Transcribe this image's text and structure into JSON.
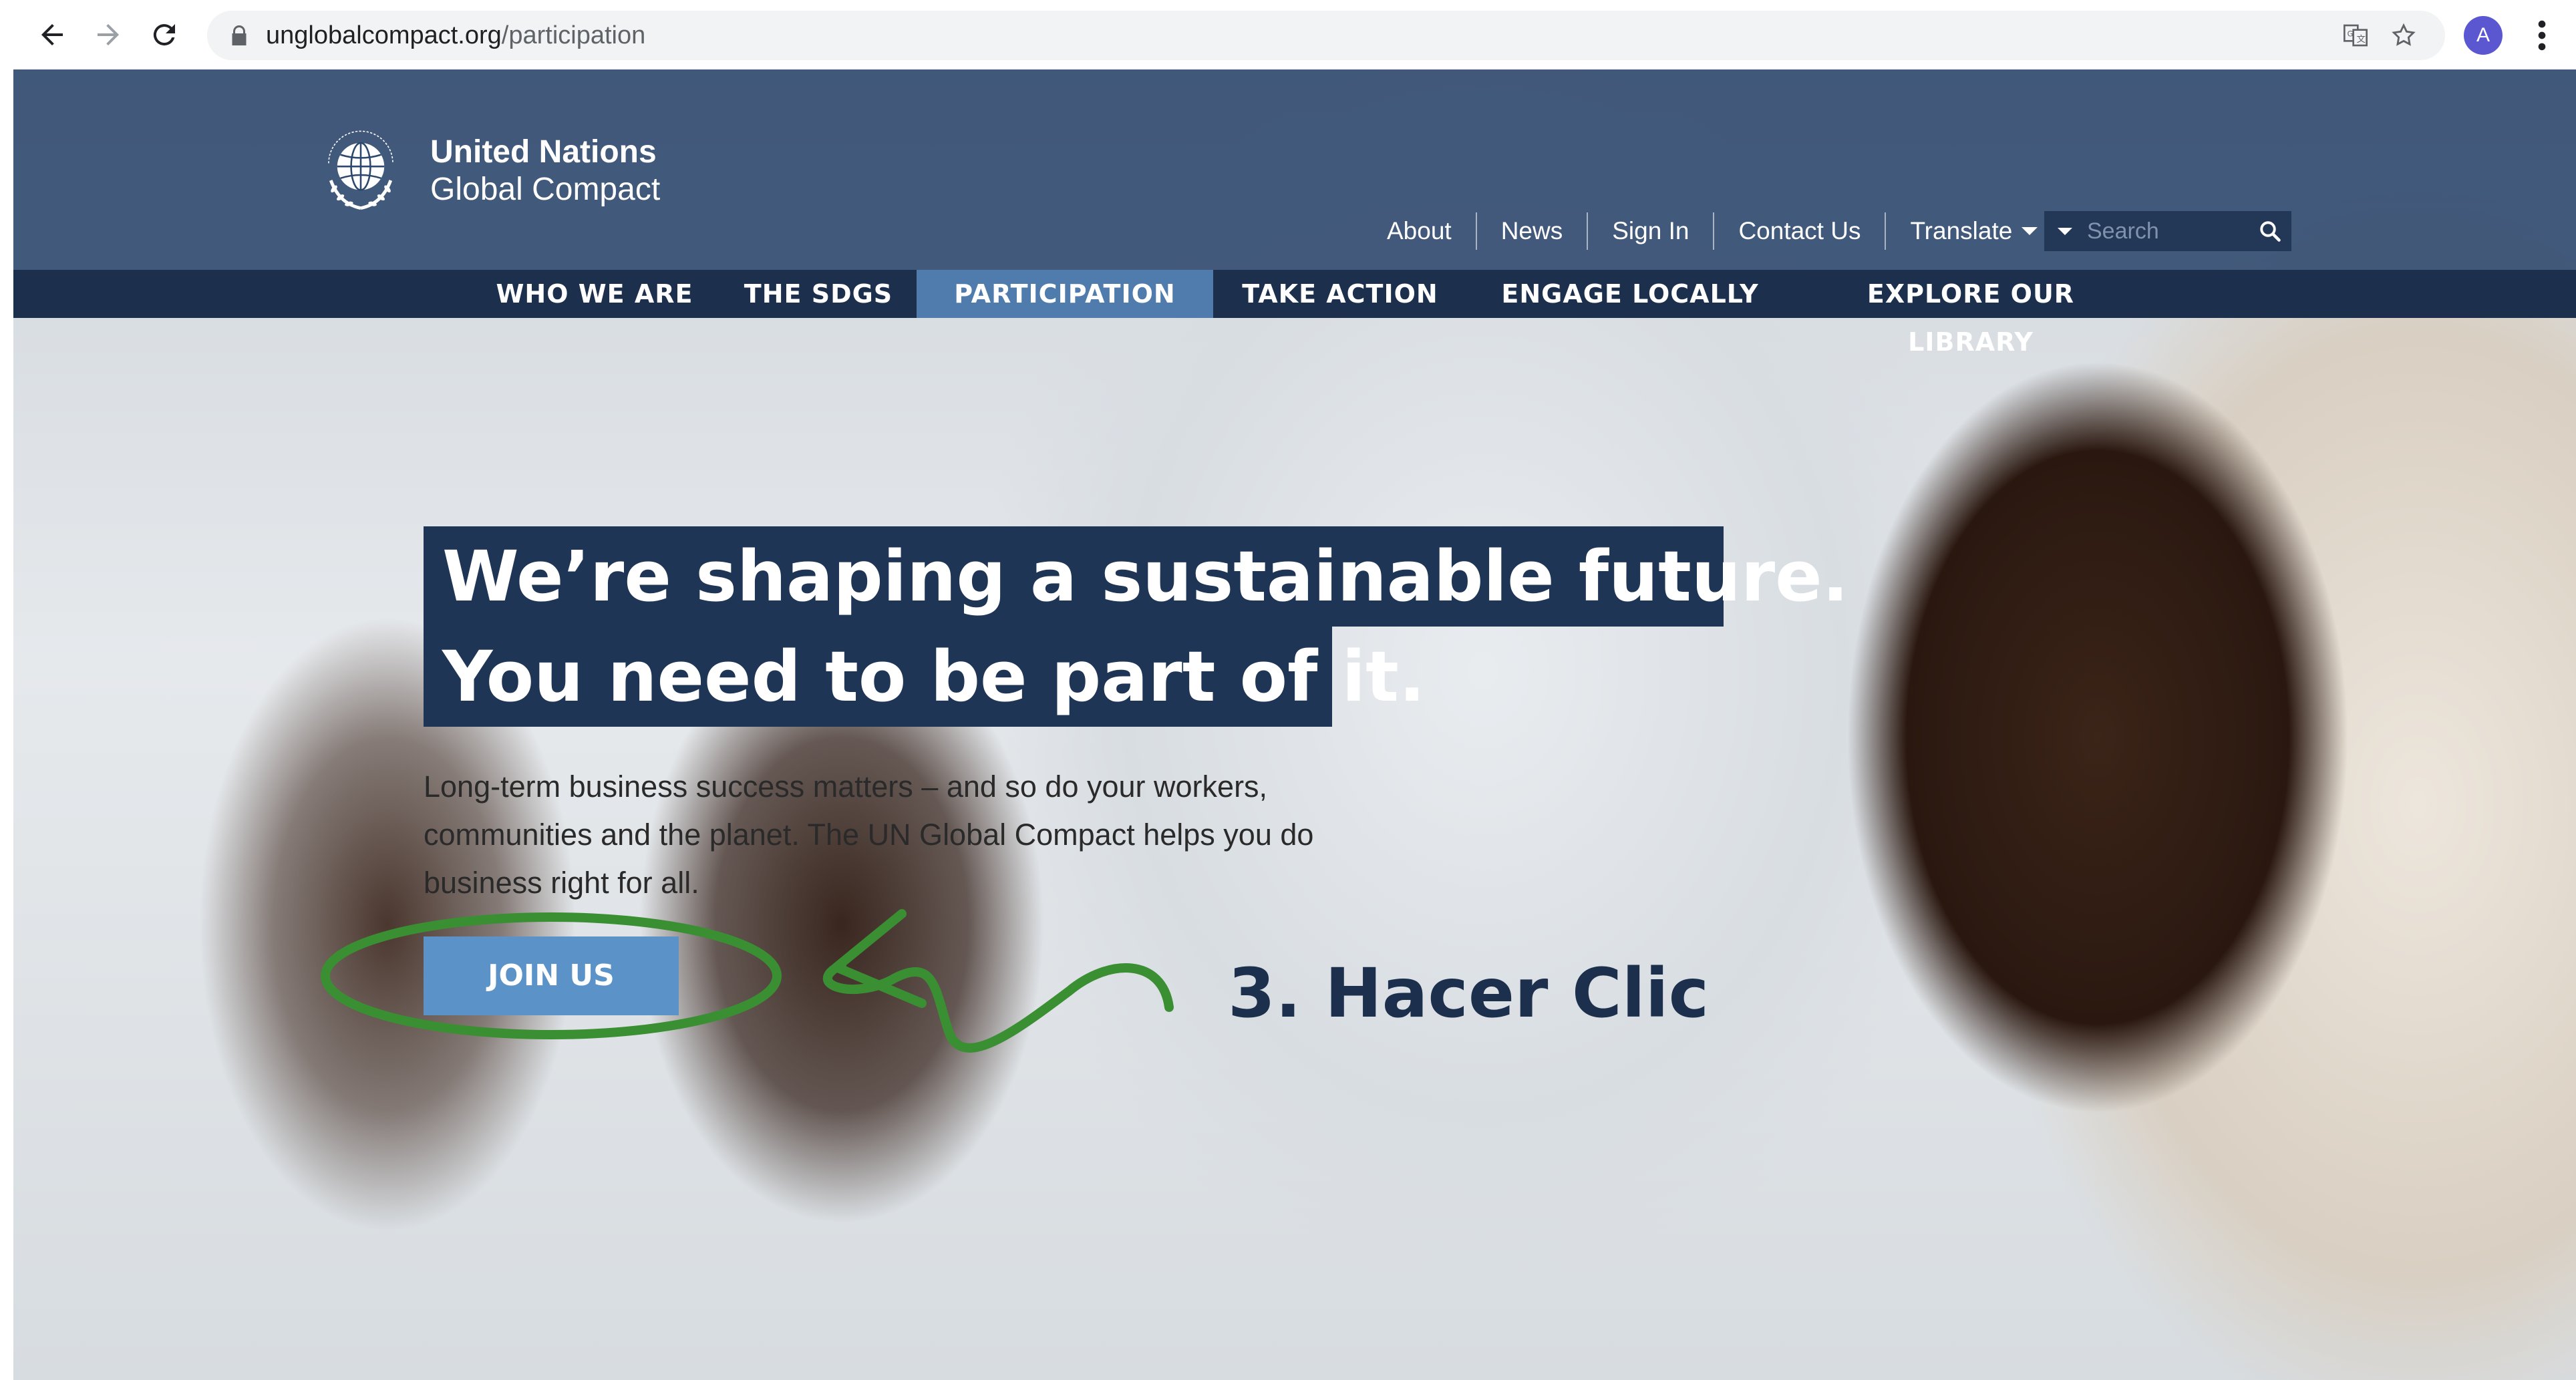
{
  "browser": {
    "url_domain": "unglobalcompact.org",
    "url_path": "/participation",
    "profile_initial": "A",
    "icons": [
      "back-arrow-icon",
      "forward-arrow-icon",
      "reload-icon",
      "lock-icon",
      "translate-page-icon",
      "bookmark-star-icon",
      "kebab-menu-icon"
    ]
  },
  "header": {
    "logo_line1": "United Nations",
    "logo_line2": "Global Compact",
    "util_links": [
      "About",
      "News",
      "Sign In",
      "Contact Us"
    ],
    "translate_label": "Translate",
    "search_placeholder": "Search"
  },
  "main_nav": {
    "items": [
      "WHO WE ARE",
      "THE SDGS",
      "PARTICIPATION",
      "TAKE ACTION",
      "ENGAGE LOCALLY",
      "EXPLORE OUR LIBRARY"
    ],
    "active": "PARTICIPATION"
  },
  "hero": {
    "headline_line1": "We’re shaping a sustainable future.",
    "headline_line2": "You need to be part of it.",
    "body_line1": "Long-term business success matters – and so do your workers,",
    "body_line2": "communities and the planet. The UN Global Compact helps you do",
    "body_line3": "business right for all.",
    "cta_label": "JOIN US"
  },
  "annotation": {
    "label": "3. Hacer Clic",
    "color": "#3b8f33"
  },
  "colors": {
    "header_bg": "#2c476c",
    "nav_bg": "#1c2f4c",
    "nav_active": "#4f7cac",
    "cta_bg": "#5b93c8",
    "headline_bg": "#1f3556"
  }
}
